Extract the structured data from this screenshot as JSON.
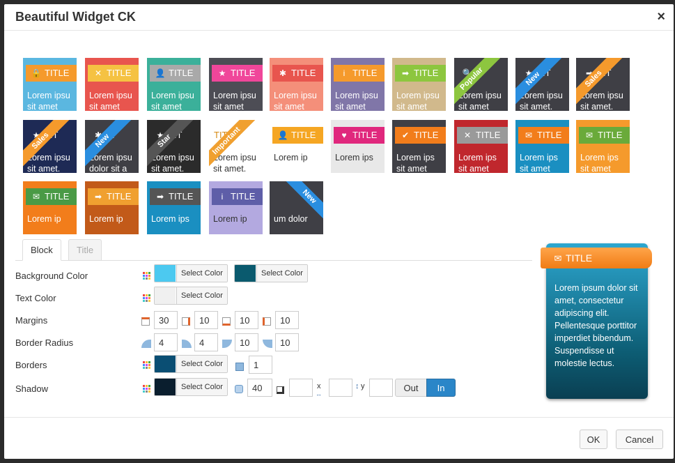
{
  "dialog": {
    "title": "Beautiful Widget CK",
    "close": "×"
  },
  "gallery": [
    {
      "bg": "#5bb7e0",
      "bar": "#f59a2c",
      "icon": "🔒",
      "title": "TITLE",
      "text1": "Lorem ipsu",
      "text2": "sit amet"
    },
    {
      "bg": "#e8554e",
      "bar": "#f5c242",
      "icon": "✕",
      "title": "TITLE",
      "text1": "Lorem ipsu",
      "text2": "sit amet"
    },
    {
      "bg": "#3bb09a",
      "bar": "#a9a9a9",
      "icon": "👤",
      "title": "TITLE",
      "text1": "Lorem ipsu",
      "text2": "sit amet"
    },
    {
      "bg": "#4d4d55",
      "bar": "#f0469a",
      "icon": "★",
      "title": "TITLE",
      "text1": "Lorem ipsu",
      "text2": "sit amet"
    },
    {
      "bg": "#f48f7a",
      "bar": "#e8554e",
      "icon": "✱",
      "title": "TITLE",
      "text1": "Lorem ipsu",
      "text2": "sit amet"
    },
    {
      "bg": "#8076a8",
      "bar": "#f59a2c",
      "icon": "i",
      "title": "TITLE",
      "text1": "Lorem ipsu",
      "text2": "sit amet"
    },
    {
      "bg": "#d1b98c",
      "bar": "#8dc63f",
      "icon": "➡",
      "title": "TITLE",
      "text1": "Lorem ipsu",
      "text2": "sit amet"
    },
    {
      "bg": "#3f3f45",
      "bar": "#3f3f45",
      "icon": "🔍",
      "title": "",
      "text1": "Lorem ipsu",
      "text2": "sit amet",
      "ribbon": "Popular",
      "ribbonColor": "#8dc63f"
    },
    {
      "bg": "#3f3f45",
      "bar": "#3f3f45",
      "icon": "★",
      "title": "TIT",
      "text1": "Lorem ipsu",
      "text2": "sit amet.",
      "ribbon": "New",
      "ribbonColor": "#2a8ee0"
    },
    {
      "bg": "#3f3f45",
      "bar": "#3f3f45",
      "icon": "➡",
      "title": "TIT",
      "text1": "Lorem ipsu",
      "text2": "sit amet.",
      "ribbon": "Sales",
      "ribbonColor": "#f59a2c"
    },
    {
      "bg": "#1e2a55",
      "bar": "#1e2a55",
      "icon": "★",
      "title": "TIT",
      "text1": "Lorem ipsu",
      "text2": "sit amet.",
      "ribbon": "Sales",
      "ribbonColor": "#f59a2c"
    },
    {
      "bg": "#3f3f45",
      "bar": "#3f3f45",
      "icon": "✱",
      "title": "TI",
      "text1": "Lorem ipsu",
      "text2": "dolor sit a",
      "ribbon": "New",
      "ribbonColor": "#2a8ee0"
    },
    {
      "bg": "#2b2b2b",
      "bar": "#2b2b2b",
      "icon": "★",
      "title": "TIT",
      "text1": "Lorem ipsu",
      "text2": "sit amet.",
      "ribbon": "Star",
      "ribbonColor": "#555"
    },
    {
      "bg": "#ffffff",
      "bar": "#ffffff",
      "icon": "",
      "title": "TIT",
      "text1": "Lorem ipsu",
      "text2": "sit amet.",
      "ribbon": "Important",
      "ribbonColor": "#f0a030",
      "dark": true
    },
    {
      "bg": "#ffffff",
      "bar": "#f5a623",
      "icon": "👤",
      "title": "TITLE",
      "text1": "Lorem ip",
      "text2": "",
      "dark": true
    },
    {
      "bg": "#e8e8e8",
      "bar": "#e0287d",
      "icon": "♥",
      "title": "TITLE",
      "text1": "Lorem ips",
      "text2": "",
      "dark": true
    },
    {
      "bg": "#3f3f45",
      "bar": "#f27d1b",
      "icon": "✔",
      "title": "TITLE",
      "text1": "Lorem ips",
      "text2": "sit amet"
    },
    {
      "bg": "#c0272d",
      "bar": "#9a9a9a",
      "icon": "✕",
      "title": "TITLE",
      "text1": "Lorem ips",
      "text2": "sit amet"
    },
    {
      "bg": "#1a8fc1",
      "bar": "#f27d1b",
      "icon": "✉",
      "title": "TITLE",
      "text1": "Lorem ips",
      "text2": "sit amet"
    },
    {
      "bg": "#f59a2c",
      "bar": "#6aaa3a",
      "icon": "✉",
      "title": "TITLE",
      "text1": "Lorem ips",
      "text2": "sit amet"
    },
    {
      "bg": "#f27d1b",
      "bar": "#4a9a46",
      "icon": "✉",
      "title": "TITLE",
      "text1": "Lorem ip",
      "text2": ""
    },
    {
      "bg": "#c25a19",
      "bar": "#f0a030",
      "icon": "➡",
      "title": "TITLE",
      "text1": "Lorem ip",
      "text2": ""
    },
    {
      "bg": "#1a8fc1",
      "bar": "#555555",
      "icon": "➡",
      "title": "TITLE",
      "text1": "Lorem ips",
      "text2": ""
    },
    {
      "bg": "#b3a9e0",
      "bar": "#5e5ea8",
      "icon": "i",
      "title": "TITLE",
      "text1": "Lorem ip",
      "text2": "",
      "dark": true
    },
    {
      "bg": "#3f3f45",
      "bar": "#3f3f45",
      "icon": "",
      "title": "",
      "text1": "um dolor",
      "text2": "",
      "ribbonRight": "New",
      "ribbonColor": "#2a8ee0"
    }
  ],
  "tabs": {
    "block": "Block",
    "title": "Title"
  },
  "form": {
    "background_color_label": "Background Color",
    "text_color_label": "Text Color",
    "margins_label": "Margins",
    "border_radius_label": "Border Radius",
    "borders_label": "Borders",
    "shadow_label": "Shadow",
    "select_color": "Select Color",
    "bg_color_1": "#4cc9f0",
    "bg_color_2": "#0a5a6e",
    "text_color": "#f0f0f0",
    "border_color": "#0a4e73",
    "shadow_color": "#0a1e2e",
    "margins": [
      "30",
      "10",
      "10",
      "10"
    ],
    "radius": [
      "4",
      "4",
      "10",
      "10"
    ],
    "border_width": "1",
    "shadow_blur": "40",
    "shadow_spread": "",
    "shadow_x": "",
    "shadow_y": "",
    "x_label": "x",
    "y_label": "y",
    "out_label": "Out",
    "in_label": "In"
  },
  "preview": {
    "title": "TITLE",
    "text": "Lorem ipsum dolor sit amet, consectetur adipiscing elit. Pellentesque porttitor imperdiet bibendum. Suspendisse ut molestie lectus."
  },
  "footer": {
    "ok": "OK",
    "cancel": "Cancel"
  }
}
